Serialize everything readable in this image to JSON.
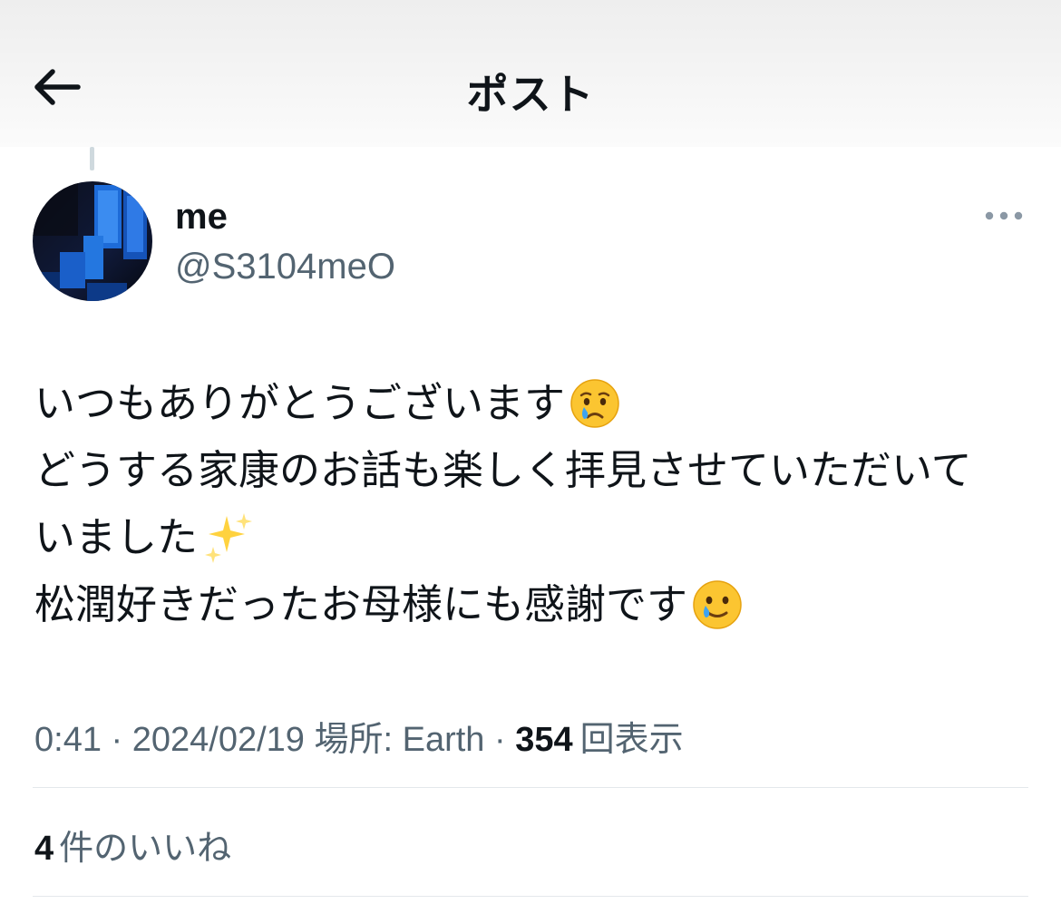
{
  "header": {
    "title": "ポスト",
    "back_icon": "arrow-left-icon"
  },
  "post": {
    "author": {
      "display_name": "me",
      "handle": "@S3104meO"
    },
    "more_icon": "more-horizontal-icon",
    "lines": [
      {
        "text": "いつもありがとうございます",
        "emoji": "crying-face"
      },
      {
        "text": "どうする家康のお話も楽しく拝見させていただいて",
        "emoji": ""
      },
      {
        "text": "いました",
        "emoji": "sparkles"
      },
      {
        "text": "松潤好きだったお母様にも感謝です",
        "emoji": "face-holding-back-tears"
      }
    ],
    "meta": {
      "time": "0:41",
      "date": "2024/02/19",
      "location": "場所: Earth",
      "separator": " · ",
      "views_count": "354",
      "views_label": "回表示"
    },
    "likes": {
      "count": "4",
      "label": "件のいいね"
    }
  },
  "colors": {
    "text_primary": "#0f1419",
    "text_secondary": "#536471",
    "divider": "#e4e8eb",
    "thread_line": "#cfd9de"
  }
}
